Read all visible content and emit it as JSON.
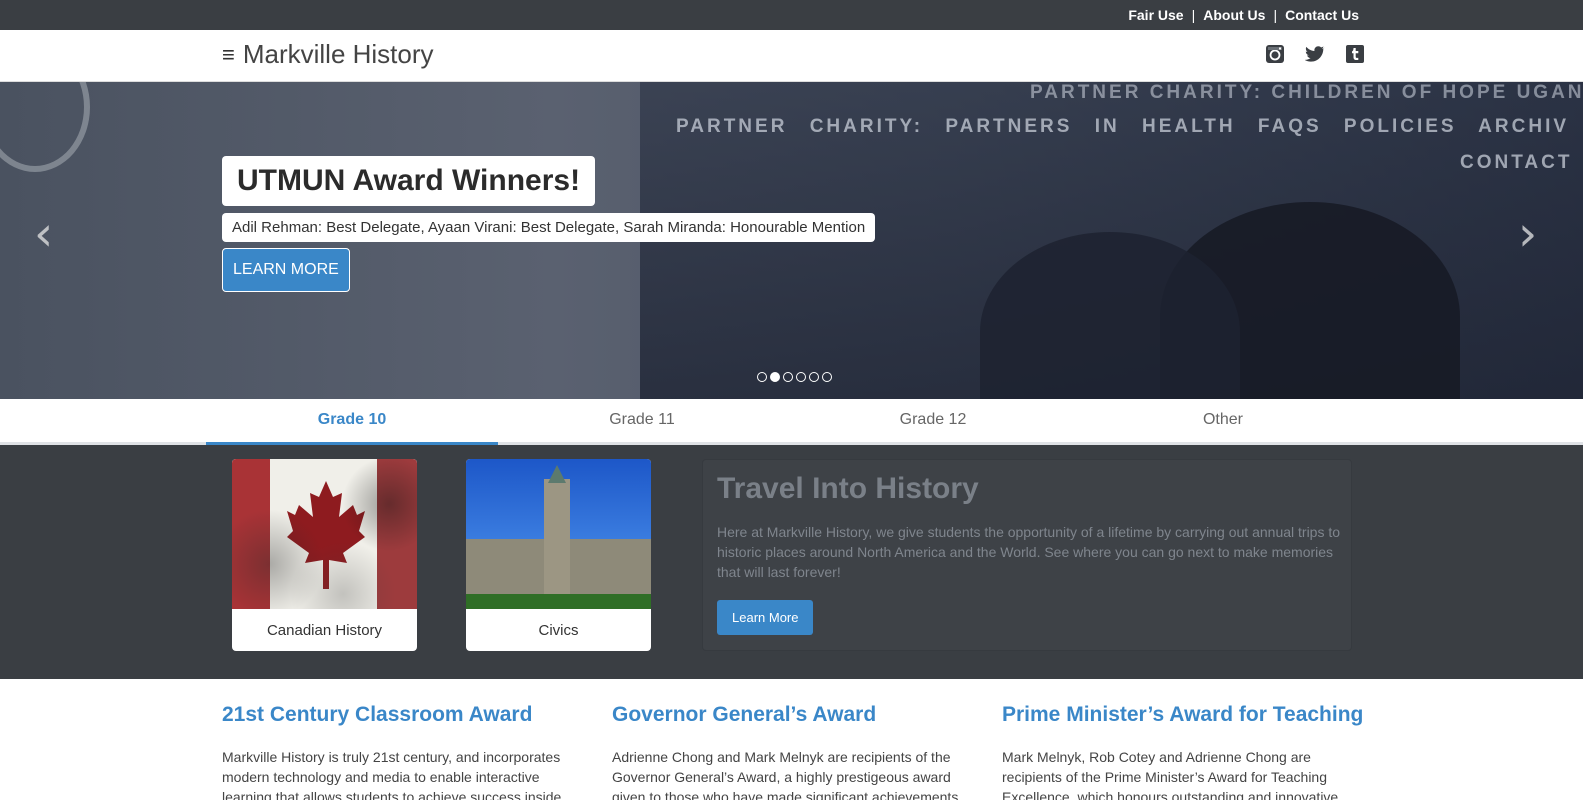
{
  "topbar": {
    "links": [
      "Fair Use",
      "About Us",
      "Contact Us"
    ],
    "separator": "|"
  },
  "header": {
    "menu_icon": "hamburger-icon",
    "brand": "Markville History",
    "social_icons": [
      "instagram-icon",
      "twitter-icon",
      "tumblr-icon"
    ]
  },
  "hero": {
    "background_signage": [
      "PARTNER CHARITY: CHILDREN OF HOPE UGAN",
      "PARTNER CHARITY: PARTNERS IN HEALTH FAQS POLICIES ARCHIV",
      "CONTACT"
    ],
    "title": "UTMUN Award Winners!",
    "subtitle": "Adil Rehman: Best Delegate, Ayaan Virani: Best Delegate, Sarah Miranda: Honourable Mention",
    "button": "LEARN MORE",
    "prev_arrow": "‹",
    "next_arrow": "›",
    "slide_count": 6,
    "active_slide": 2
  },
  "tabs": [
    {
      "label": "Grade 10",
      "active": true
    },
    {
      "label": "Grade 11",
      "active": false
    },
    {
      "label": "Grade 12",
      "active": false
    },
    {
      "label": "Other",
      "active": false
    }
  ],
  "cards": [
    {
      "label": "Canadian History",
      "image": "canadian-flag-image"
    },
    {
      "label": "Civics",
      "image": "parliament-building-image"
    }
  ],
  "travel": {
    "title": "Travel Into History",
    "text": "Here at Markville History, we give students the opportunity of a lifetime by carrying out annual trips to historic places around North America and the World. See where you can go next to make memories that will last forever!",
    "button": "Learn More"
  },
  "awards": [
    {
      "title": "21st Century Classroom Award",
      "text": "Markville History is truly 21st century, and incorporates modern technology and media to enable interactive learning that allows students to achieve success inside and"
    },
    {
      "title": "Governor General’s Award",
      "text": "Adrienne Chong and Mark Melnyk are recipients of the Governor General’s Award, a highly prestigeous award given to those who have made significant achievements"
    },
    {
      "title": "Prime Minister’s Award for Teaching",
      "text": "Mark Melnyk, Rob Cotey and Adrienne Chong are recipients of the Prime Minister’s Award for Teaching Excellence, which honours outstanding and innovative"
    }
  ],
  "colors": {
    "accent": "#3a87c8",
    "dark_bar": "#3a3e43"
  }
}
